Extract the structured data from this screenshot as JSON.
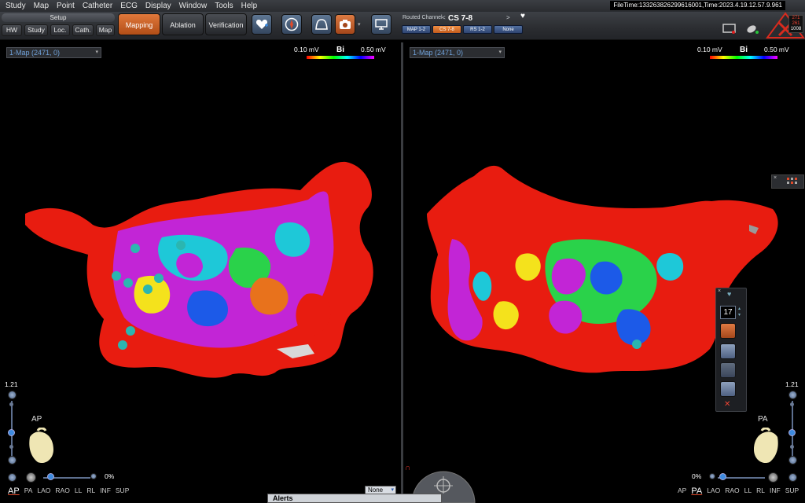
{
  "menubar": {
    "items": [
      "Study",
      "Map",
      "Point",
      "Catheter",
      "ECG",
      "Display",
      "Window",
      "Tools",
      "Help"
    ],
    "filetime": "FileTime:133263826299616001,Time:2023.4.19.12.57.9.961"
  },
  "toolbar": {
    "setup_title": "Setup",
    "setup_buttons": [
      "HW",
      "Study",
      "Loc.",
      "Cath.",
      "Map"
    ],
    "modes": {
      "mapping": "Mapping",
      "ablation": "Ablation",
      "verification": "Verification"
    },
    "routed": {
      "label": "Routed Channel",
      "channel": "CS 7-8",
      "tabs": [
        "MAP 1-2",
        "CS 7-8",
        "RS 1-2",
        "None"
      ]
    },
    "status": {
      "values": [
        "271",
        "261",
        "1008"
      ]
    }
  },
  "left_view": {
    "map_select": "1-Map (2471, 0)",
    "legend": {
      "min": "0.10 mV",
      "name": "Bi",
      "max": "0.50 mV"
    },
    "scale": "1.21",
    "orientation": "AP",
    "zoom_pct": "0%",
    "view_buttons": [
      "AP",
      "PA",
      "LAO",
      "RAO",
      "LL",
      "RL",
      "INF",
      "SUP"
    ],
    "active_view": "AP"
  },
  "right_view": {
    "map_select": "1-Map (2471, 0)",
    "legend": {
      "min": "0.10 mV",
      "name": "Bi",
      "max": "0.50 mV"
    },
    "scale": "1.21",
    "orientation": "PA",
    "zoom_pct": "0%",
    "view_buttons": [
      "AP",
      "PA",
      "LAO",
      "RAO",
      "LL",
      "RL",
      "INF",
      "SUP"
    ],
    "active_view": "PA",
    "panel_number": "17"
  },
  "bottom": {
    "none_select": "None",
    "alert_text": "Alerts"
  },
  "colors": {
    "accent_orange": "#e0783b",
    "menubar": "#2a2c30",
    "map_red": "#e81c10",
    "map_magenta": "#c225d6"
  }
}
